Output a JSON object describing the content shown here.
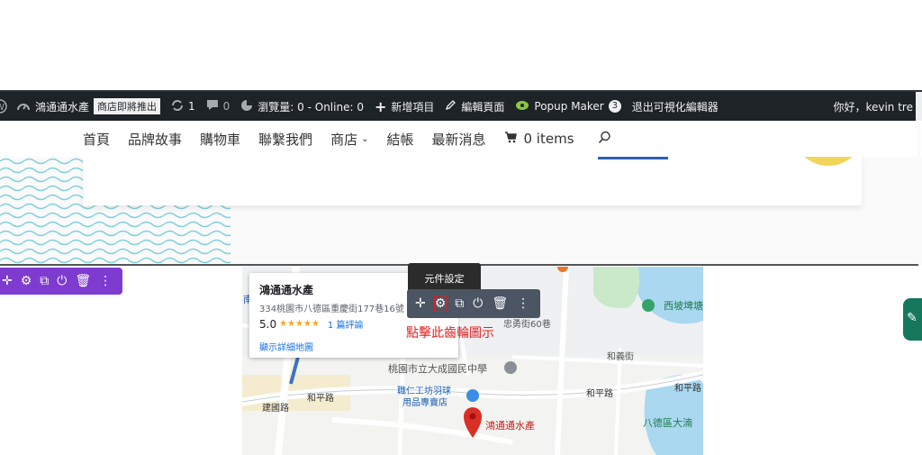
{
  "admin_bar": {
    "site_name": "鴻通通水產",
    "store_badge": "商店即將推出",
    "updates_count": "1",
    "comments_count": "0",
    "stats": "瀏覽量: 0 - Online: 0",
    "new_item": "新增項目",
    "edit_page": "編輯頁面",
    "popup_maker": "Popup Maker",
    "popup_count": "3",
    "exit_editor": "退出可視化編輯器",
    "greeting": "你好，kevin tre"
  },
  "nav": {
    "items": [
      "首頁",
      "品牌故事",
      "購物車",
      "聯繫我們",
      "商店",
      "結帳",
      "最新消息"
    ],
    "cart": "0 items"
  },
  "map": {
    "place_name": "鴻通通水產",
    "address": "334桃園市八德區重慶街177巷16號",
    "rating": "5.0",
    "stars": "★★★★★",
    "reviews": "1 篇評論",
    "view_larger": "顯示詳細地圖",
    "labels": {
      "west_park": "西坡埤塘",
      "school": "桃園市立大成國民中學",
      "shop1": "職仁工坊羽球",
      "shop2": "用品專賣店",
      "road1": "和平路",
      "road2": "建國路",
      "road3": "和平路",
      "road4": "和平路",
      "road5": "忠勇街60巷",
      "road6": "和義街",
      "district": "八德區大湳",
      "pin": "鴻通通水產",
      "south": "南"
    }
  },
  "tooltip": "元件設定",
  "hint": "點擊此齒輪圖示",
  "colors": {
    "admin_bar_bg": "#1d2327",
    "purple_toolbar": "#7e3bd0",
    "dark_toolbar": "#4b5563",
    "hint_red": "#e02020"
  }
}
